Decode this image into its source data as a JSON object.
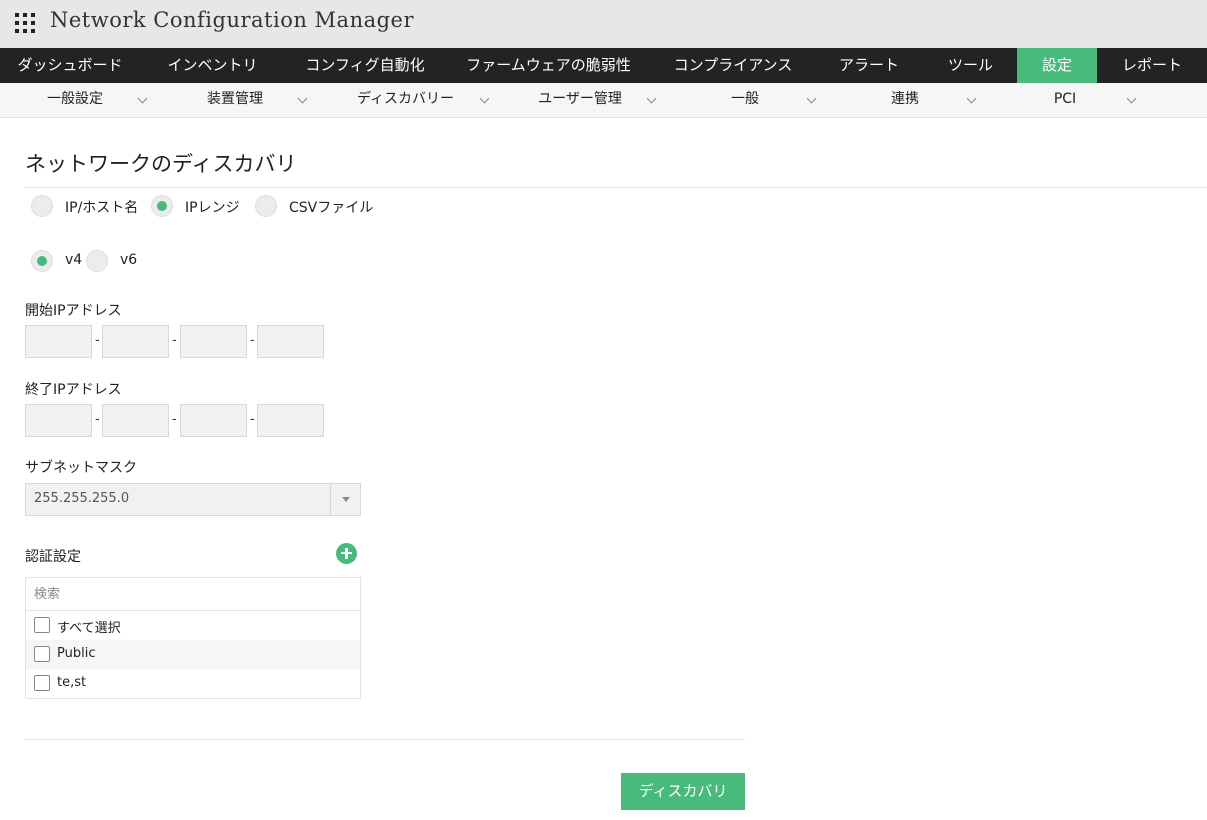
{
  "app": {
    "title": "Network Configuration Manager",
    "icon": "apps-grid-icon"
  },
  "main_nav": {
    "items": [
      {
        "label": "ダッシュボード",
        "active": false
      },
      {
        "label": "インベントリ",
        "active": false
      },
      {
        "label": "コンフィグ自動化",
        "active": false
      },
      {
        "label": "ファームウェアの脆弱性",
        "active": false
      },
      {
        "label": "コンプライアンス",
        "active": false
      },
      {
        "label": "アラート",
        "active": false
      },
      {
        "label": "ツール",
        "active": false
      },
      {
        "label": "設定",
        "active": true
      },
      {
        "label": "レポート",
        "active": false
      }
    ]
  },
  "sub_nav": {
    "items": [
      {
        "label": "一般設定",
        "active": false
      },
      {
        "label": "装置管理",
        "active": false
      },
      {
        "label": "ディスカバリー",
        "active": true
      },
      {
        "label": "ユーザー管理",
        "active": false
      },
      {
        "label": "一般",
        "active": false
      },
      {
        "label": "連携",
        "active": false
      },
      {
        "label": "PCI",
        "active": false
      }
    ]
  },
  "page": {
    "title": "ネットワークのディスカバリ"
  },
  "discovery_mode": {
    "options": [
      {
        "label": "IP/ホスト名",
        "checked": false
      },
      {
        "label": "IPレンジ",
        "checked": true
      },
      {
        "label": "CSVファイル",
        "checked": false
      }
    ]
  },
  "ip_version": {
    "options": [
      {
        "label": "v4",
        "checked": true
      },
      {
        "label": "v6",
        "checked": false
      }
    ]
  },
  "start_ip": {
    "label": "開始IPアドレス",
    "octets": [
      "",
      "",
      "",
      ""
    ],
    "separator": "-"
  },
  "end_ip": {
    "label": "終了IPアドレス",
    "octets": [
      "",
      "",
      "",
      ""
    ],
    "separator": "-"
  },
  "subnet_mask": {
    "label": "サブネットマスク",
    "value": "255.255.255.0"
  },
  "credentials": {
    "label": "認証設定",
    "search_placeholder": "検索",
    "items": [
      {
        "label": "すべて選択",
        "checked": false
      },
      {
        "label": "Public",
        "checked": false
      },
      {
        "label": "te,st",
        "checked": false
      }
    ]
  },
  "actions": {
    "discover_label": "ディスカバリ"
  },
  "colors": {
    "accent": "#48ba7b",
    "nav_bg": "#232323",
    "titlebar_bg": "#e7e7e7"
  }
}
